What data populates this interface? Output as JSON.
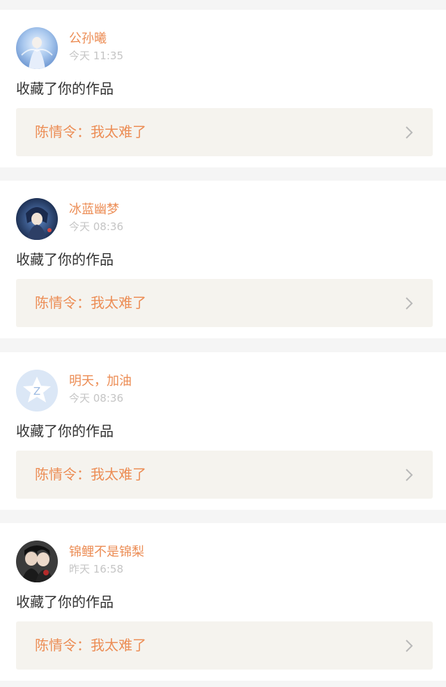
{
  "feed": {
    "items": [
      {
        "username": "公孙曦",
        "time": "今天 11:35",
        "action": "收藏了你的作品",
        "work_title": "陈情令：我太难了"
      },
      {
        "username": "冰蓝幽梦",
        "time": "今天 08:36",
        "action": "收藏了你的作品",
        "work_title": "陈情令：我太难了"
      },
      {
        "username": "明天，加油",
        "time": "今天 08:36",
        "action": "收藏了你的作品",
        "work_title": "陈情令：我太难了"
      },
      {
        "username": "锦鲤不是锦梨",
        "time": "昨天 16:58",
        "action": "收藏了你的作品",
        "work_title": "陈情令：我太难了"
      }
    ]
  },
  "colors": {
    "accent": "#ec8d55",
    "timestamp": "#c5c5c5",
    "body_text": "#333333",
    "work_card_bg": "#f5f3ee",
    "page_bg": "#f5f5f5"
  },
  "icons": {
    "chevron": "chevron-right-icon"
  }
}
